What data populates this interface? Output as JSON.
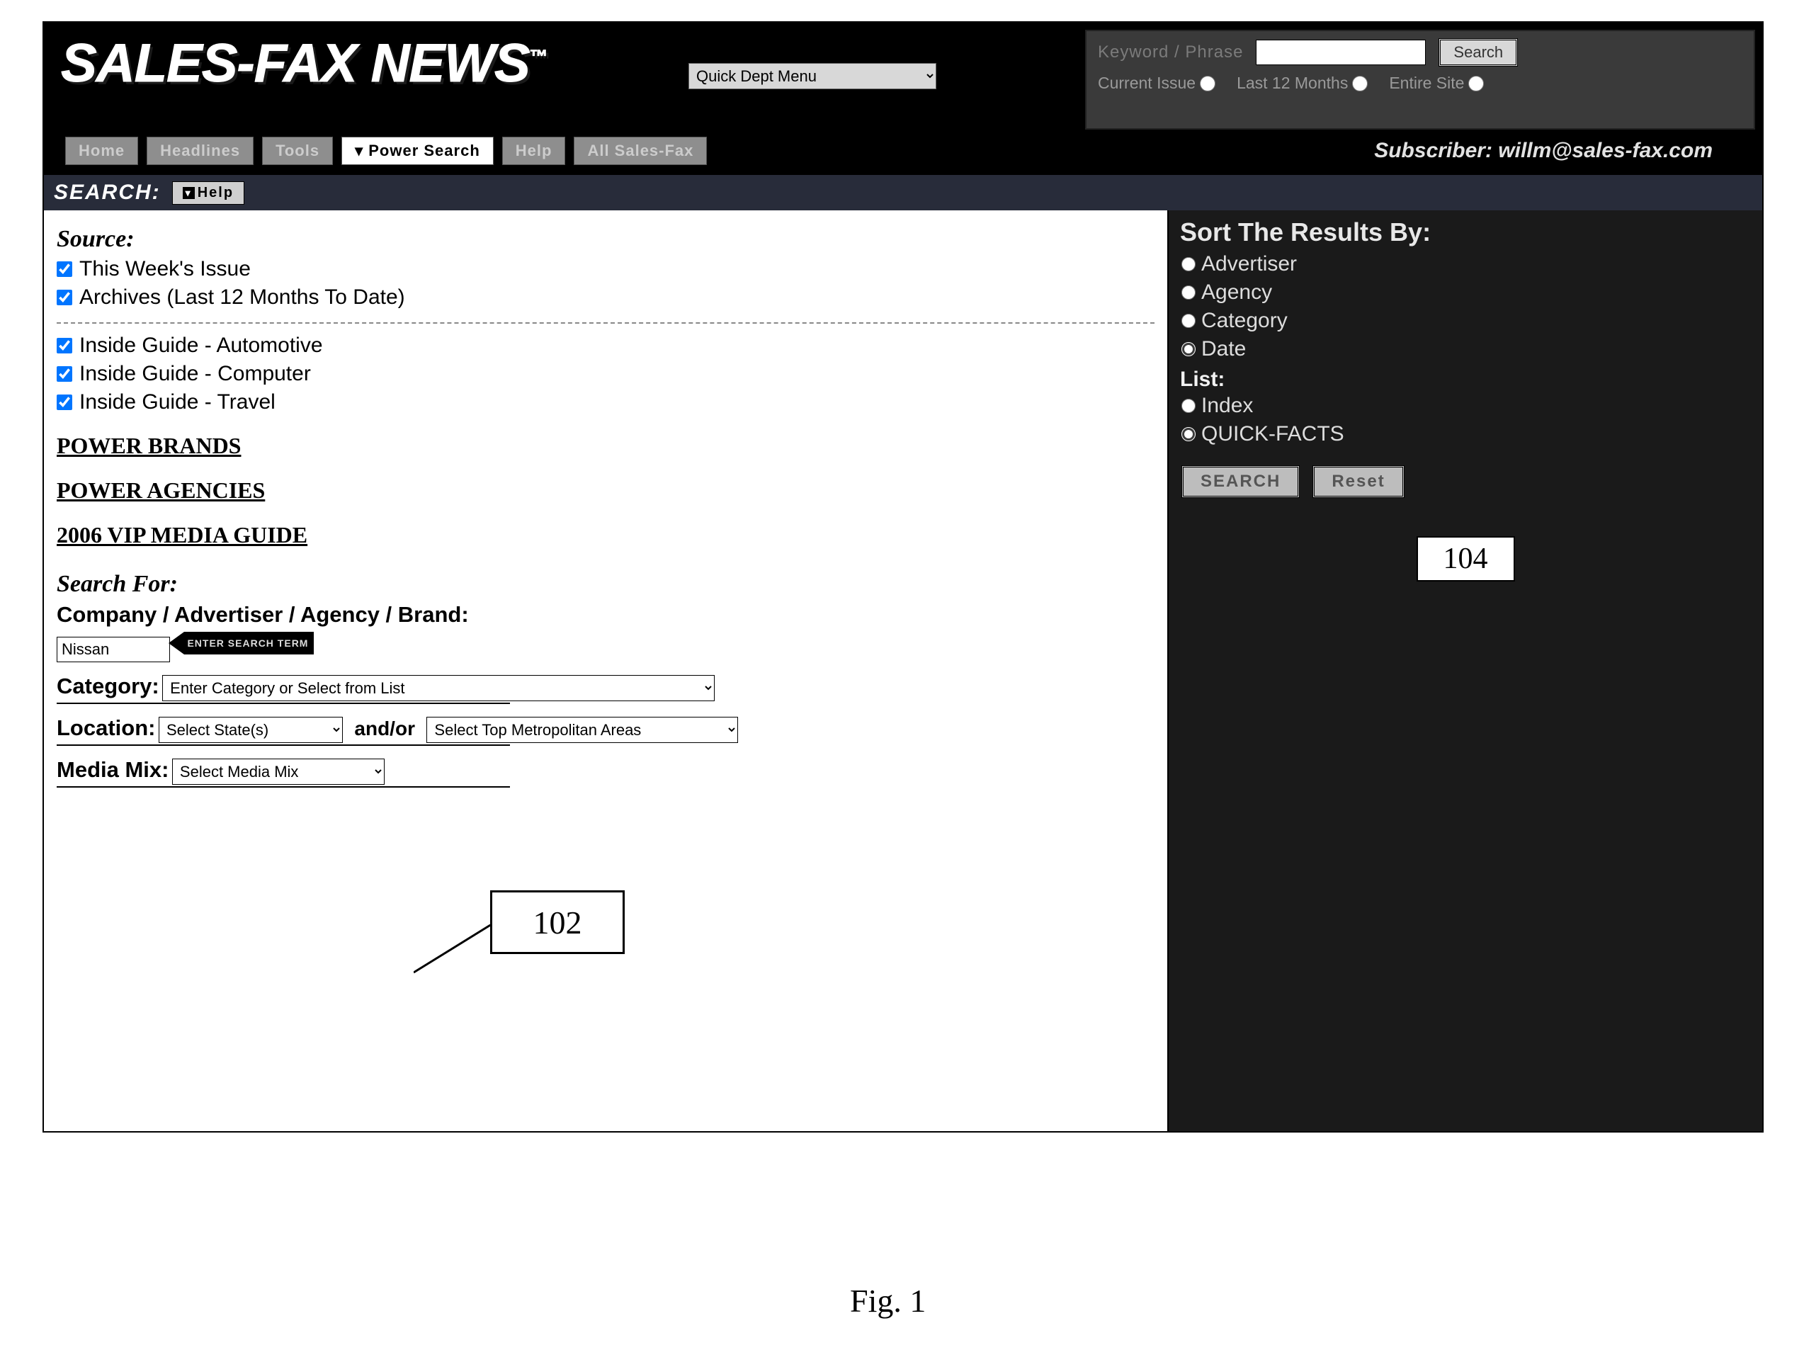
{
  "header": {
    "logo_text": "SALES-FAX NEWS",
    "logo_tm": "™",
    "quick_menu_placeholder": "Quick Dept Menu",
    "top_search": {
      "label": "Keyword / Phrase",
      "button": "Search",
      "scopes": [
        {
          "label": "Current Issue"
        },
        {
          "label": "Last 12 Months"
        },
        {
          "label": "Entire Site"
        }
      ]
    }
  },
  "nav": {
    "items": [
      "Home",
      "Headlines",
      "Tools",
      "▾ Power Search",
      "Help",
      "All Sales-Fax"
    ],
    "active_index": 3,
    "subscriber_label": "Subscriber:",
    "subscriber_value": "willm@sales-fax.com"
  },
  "searchbar": {
    "title": "SEARCH:",
    "help": "Help"
  },
  "source": {
    "heading": "Source:",
    "options_a": [
      "This Week's Issue",
      "Archives (Last 12 Months To Date)"
    ],
    "options_b": [
      "Inside Guide - Automotive",
      "Inside Guide - Computer",
      "Inside Guide - Travel"
    ],
    "links": [
      "POWER BRANDS",
      "POWER AGENCIES",
      "2006 VIP MEDIA GUIDE"
    ]
  },
  "form": {
    "search_for": "Search For:",
    "cab": "Company / Advertiser / Agency / Brand:",
    "cab_value": "Nissan",
    "arrow_text": "ENTER SEARCH TERM",
    "category_label": "Category:",
    "category_placeholder": "Enter Category or Select from List",
    "location_label": "Location:",
    "state_placeholder": "Select State(s)",
    "and_or": "and/or",
    "metro_placeholder": "Select Top Metropolitan Areas",
    "media_label": "Media Mix:",
    "media_placeholder": "Select Media Mix"
  },
  "sort": {
    "title": "Sort The Results By:",
    "items": [
      "Advertiser",
      "Agency",
      "Category",
      "Date"
    ],
    "list_label": "List:",
    "list_items": [
      "Index",
      "QUICK-FACTS"
    ],
    "search_btn": "SEARCH",
    "reset_btn": "Reset"
  },
  "annotations": {
    "box102": "102",
    "box104": "104",
    "figure": "Fig. 1"
  }
}
